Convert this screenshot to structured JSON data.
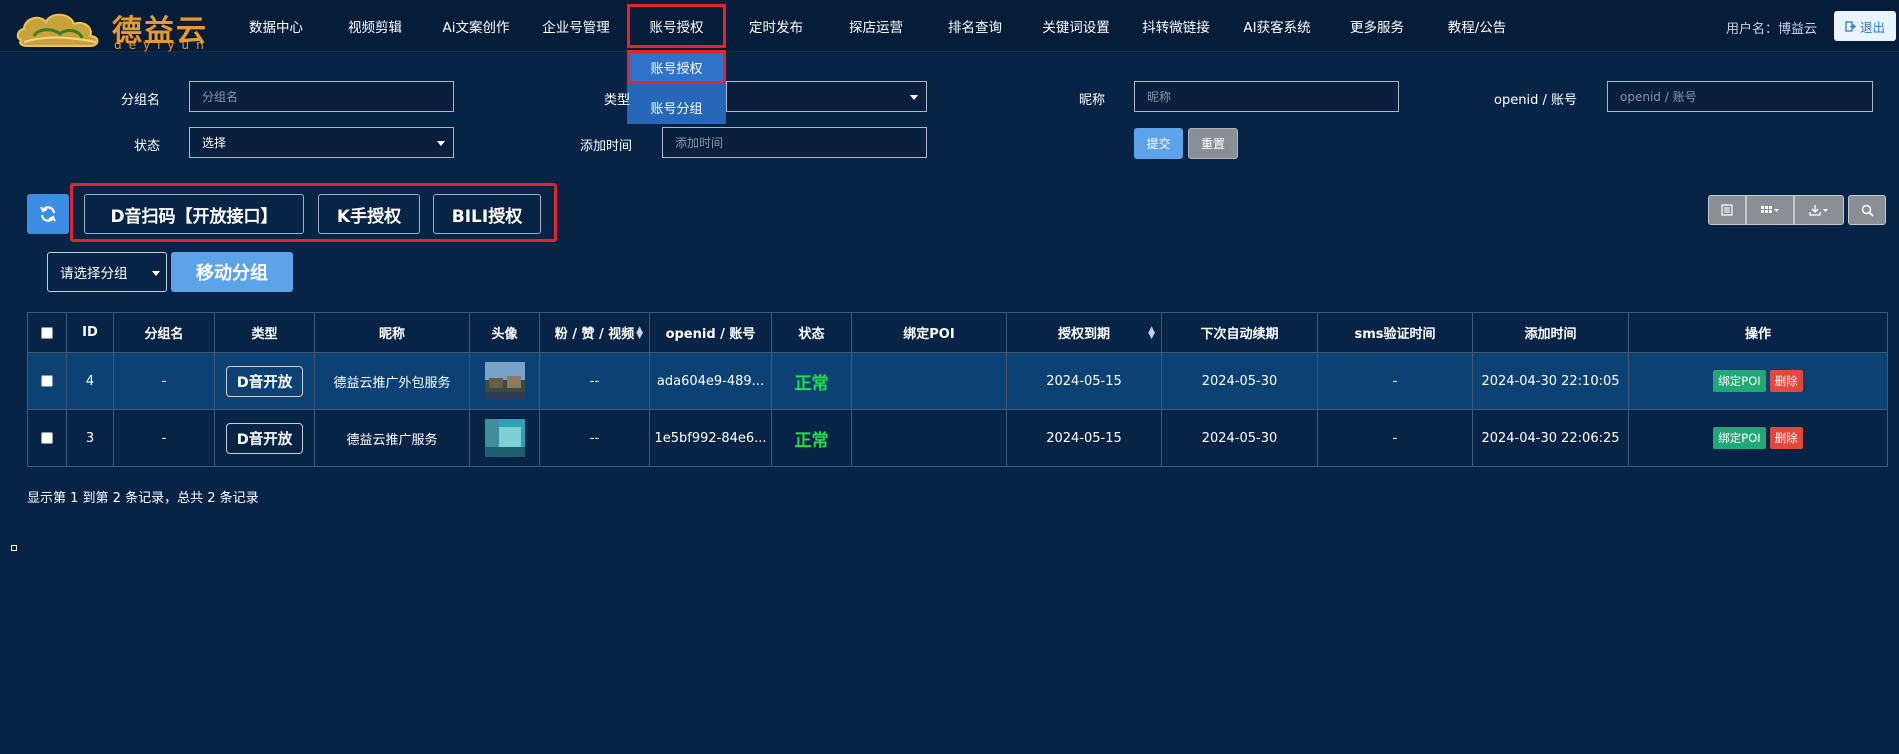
{
  "brand": {
    "name": "德益云",
    "sub": "deyiyun",
    "color": "#e99a2d"
  },
  "nav": [
    {
      "label": "数据中心"
    },
    {
      "label": "视频剪辑"
    },
    {
      "label": "Ai文案创作"
    },
    {
      "label": "企业号管理"
    },
    {
      "label": "账号授权",
      "active": true
    },
    {
      "label": "定时发布"
    },
    {
      "label": "探店运营"
    },
    {
      "label": "排名查询"
    },
    {
      "label": "关键词设置"
    },
    {
      "label": "抖转微链接"
    },
    {
      "label": "AI获客系统"
    },
    {
      "label": "更多服务"
    },
    {
      "label": "教程/公告"
    }
  ],
  "user": {
    "label": "用户名：博益云",
    "logout": "退出"
  },
  "dropdown": {
    "items": [
      "账号授权",
      "账号分组"
    ]
  },
  "filters": {
    "group_label": "分组名",
    "group_placeholder": "分组名",
    "type_label": "类型",
    "nickname_label": "昵称",
    "nickname_placeholder": "昵称",
    "openid_label": "openid / 账号",
    "openid_placeholder": "openid / 账号",
    "status_label": "状态",
    "status_value": "选择",
    "addtime_label": "添加时间",
    "addtime_placeholder": "添加时间",
    "submit": "提交",
    "reset": "重置"
  },
  "toolbar": {
    "auth_buttons": [
      "D音扫码【开放接口】",
      "K手授权",
      "BILI授权"
    ],
    "group_select": "请选择分组",
    "move_group": "移动分组"
  },
  "table": {
    "columns": [
      "",
      "ID",
      "分组名",
      "类型",
      "昵称",
      "头像",
      "粉 / 赞 / 视频",
      "openid / 账号",
      "状态",
      "绑定POI",
      "授权到期",
      "下次自动续期",
      "sms验证时间",
      "添加时间",
      "操作"
    ],
    "rows": [
      {
        "id": "4",
        "group": "-",
        "type": "D音开放",
        "nickname": "德益云推广外包服务",
        "stats": "--",
        "openid": "ada604e9-489...",
        "status": "正常",
        "poi": "",
        "expire": "2024-05-15",
        "renew": "2024-05-30",
        "sms": "-",
        "added": "2024-04-30 22:10:05",
        "bind": "绑定POI",
        "del": "删除"
      },
      {
        "id": "3",
        "group": "-",
        "type": "D音开放",
        "nickname": "德益云推广服务",
        "stats": "--",
        "openid": "1e5bf992-84e6...",
        "status": "正常",
        "poi": "",
        "expire": "2024-05-15",
        "renew": "2024-05-30",
        "sms": "-",
        "added": "2024-04-30 22:06:25",
        "bind": "绑定POI",
        "del": "删除"
      }
    ]
  },
  "footer": {
    "summary": "显示第 1 到第 2 条记录，总共 2 条记录"
  },
  "colors": {
    "bg": "#072447",
    "accent": "#5ca3ea",
    "highlight": "#e3242b",
    "ok": "#1ee04a"
  }
}
